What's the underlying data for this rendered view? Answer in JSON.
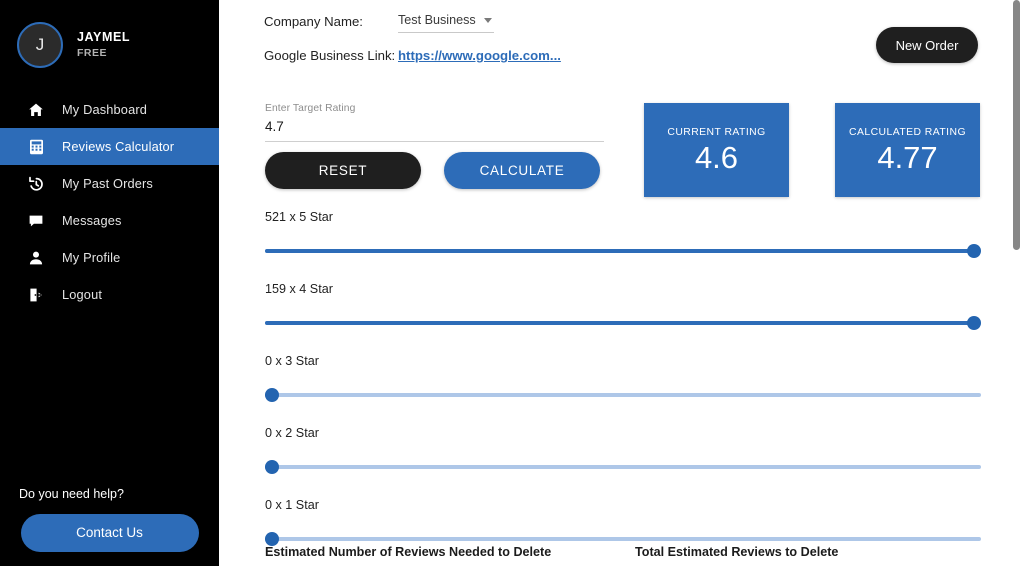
{
  "sidebar": {
    "profile": {
      "initial": "J",
      "name": "JAYMEL",
      "plan": "FREE"
    },
    "items": [
      {
        "label": "My Dashboard",
        "icon": "home-icon",
        "active": false
      },
      {
        "label": "Reviews Calculator",
        "icon": "calculator-icon",
        "active": true
      },
      {
        "label": "My Past Orders",
        "icon": "history-icon",
        "active": false
      },
      {
        "label": "Messages",
        "icon": "chat-icon",
        "active": false
      },
      {
        "label": "My Profile",
        "icon": "person-icon",
        "active": false
      },
      {
        "label": "Logout",
        "icon": "logout-icon",
        "active": false
      }
    ],
    "help_text": "Do you need help?",
    "contact_label": "Contact Us"
  },
  "header": {
    "company_label": "Company Name:",
    "company_value": "Test Business",
    "link_label": "Google Business Link:",
    "link_value": "https://www.google.com",
    "link_tail": "...",
    "new_order_label": "New Order"
  },
  "target": {
    "label": "Enter Target Rating",
    "value": "4.7",
    "placeholder": "Enter Target Rating",
    "reset_label": "RESET",
    "calculate_label": "CALCULATE"
  },
  "stats": [
    {
      "label": "CURRENT RATING",
      "value": "4.6"
    },
    {
      "label": "CALCULATED RATING",
      "value": "4.77"
    }
  ],
  "sliders": [
    {
      "label": "521 x 5 Star",
      "count": 521,
      "stars": 5,
      "percent": 100
    },
    {
      "label": "159 x 4 Star",
      "count": 159,
      "stars": 4,
      "percent": 100
    },
    {
      "label": "0 x 3 Star",
      "count": 0,
      "stars": 3,
      "percent": 0
    },
    {
      "label": "0 x 2 Star",
      "count": 0,
      "stars": 2,
      "percent": 0
    },
    {
      "label": "0 x 1 Star",
      "count": 0,
      "stars": 1,
      "percent": 0
    }
  ],
  "footer": {
    "col_a": "Estimated Number of Reviews Needed to Delete",
    "col_b": "Total Estimated Reviews to Delete"
  },
  "colors": {
    "accent_blue": "#2d6cb8",
    "sidebar_bg": "#000000",
    "dark_button": "#1f1f1f",
    "track_inactive": "#aec7e8"
  }
}
